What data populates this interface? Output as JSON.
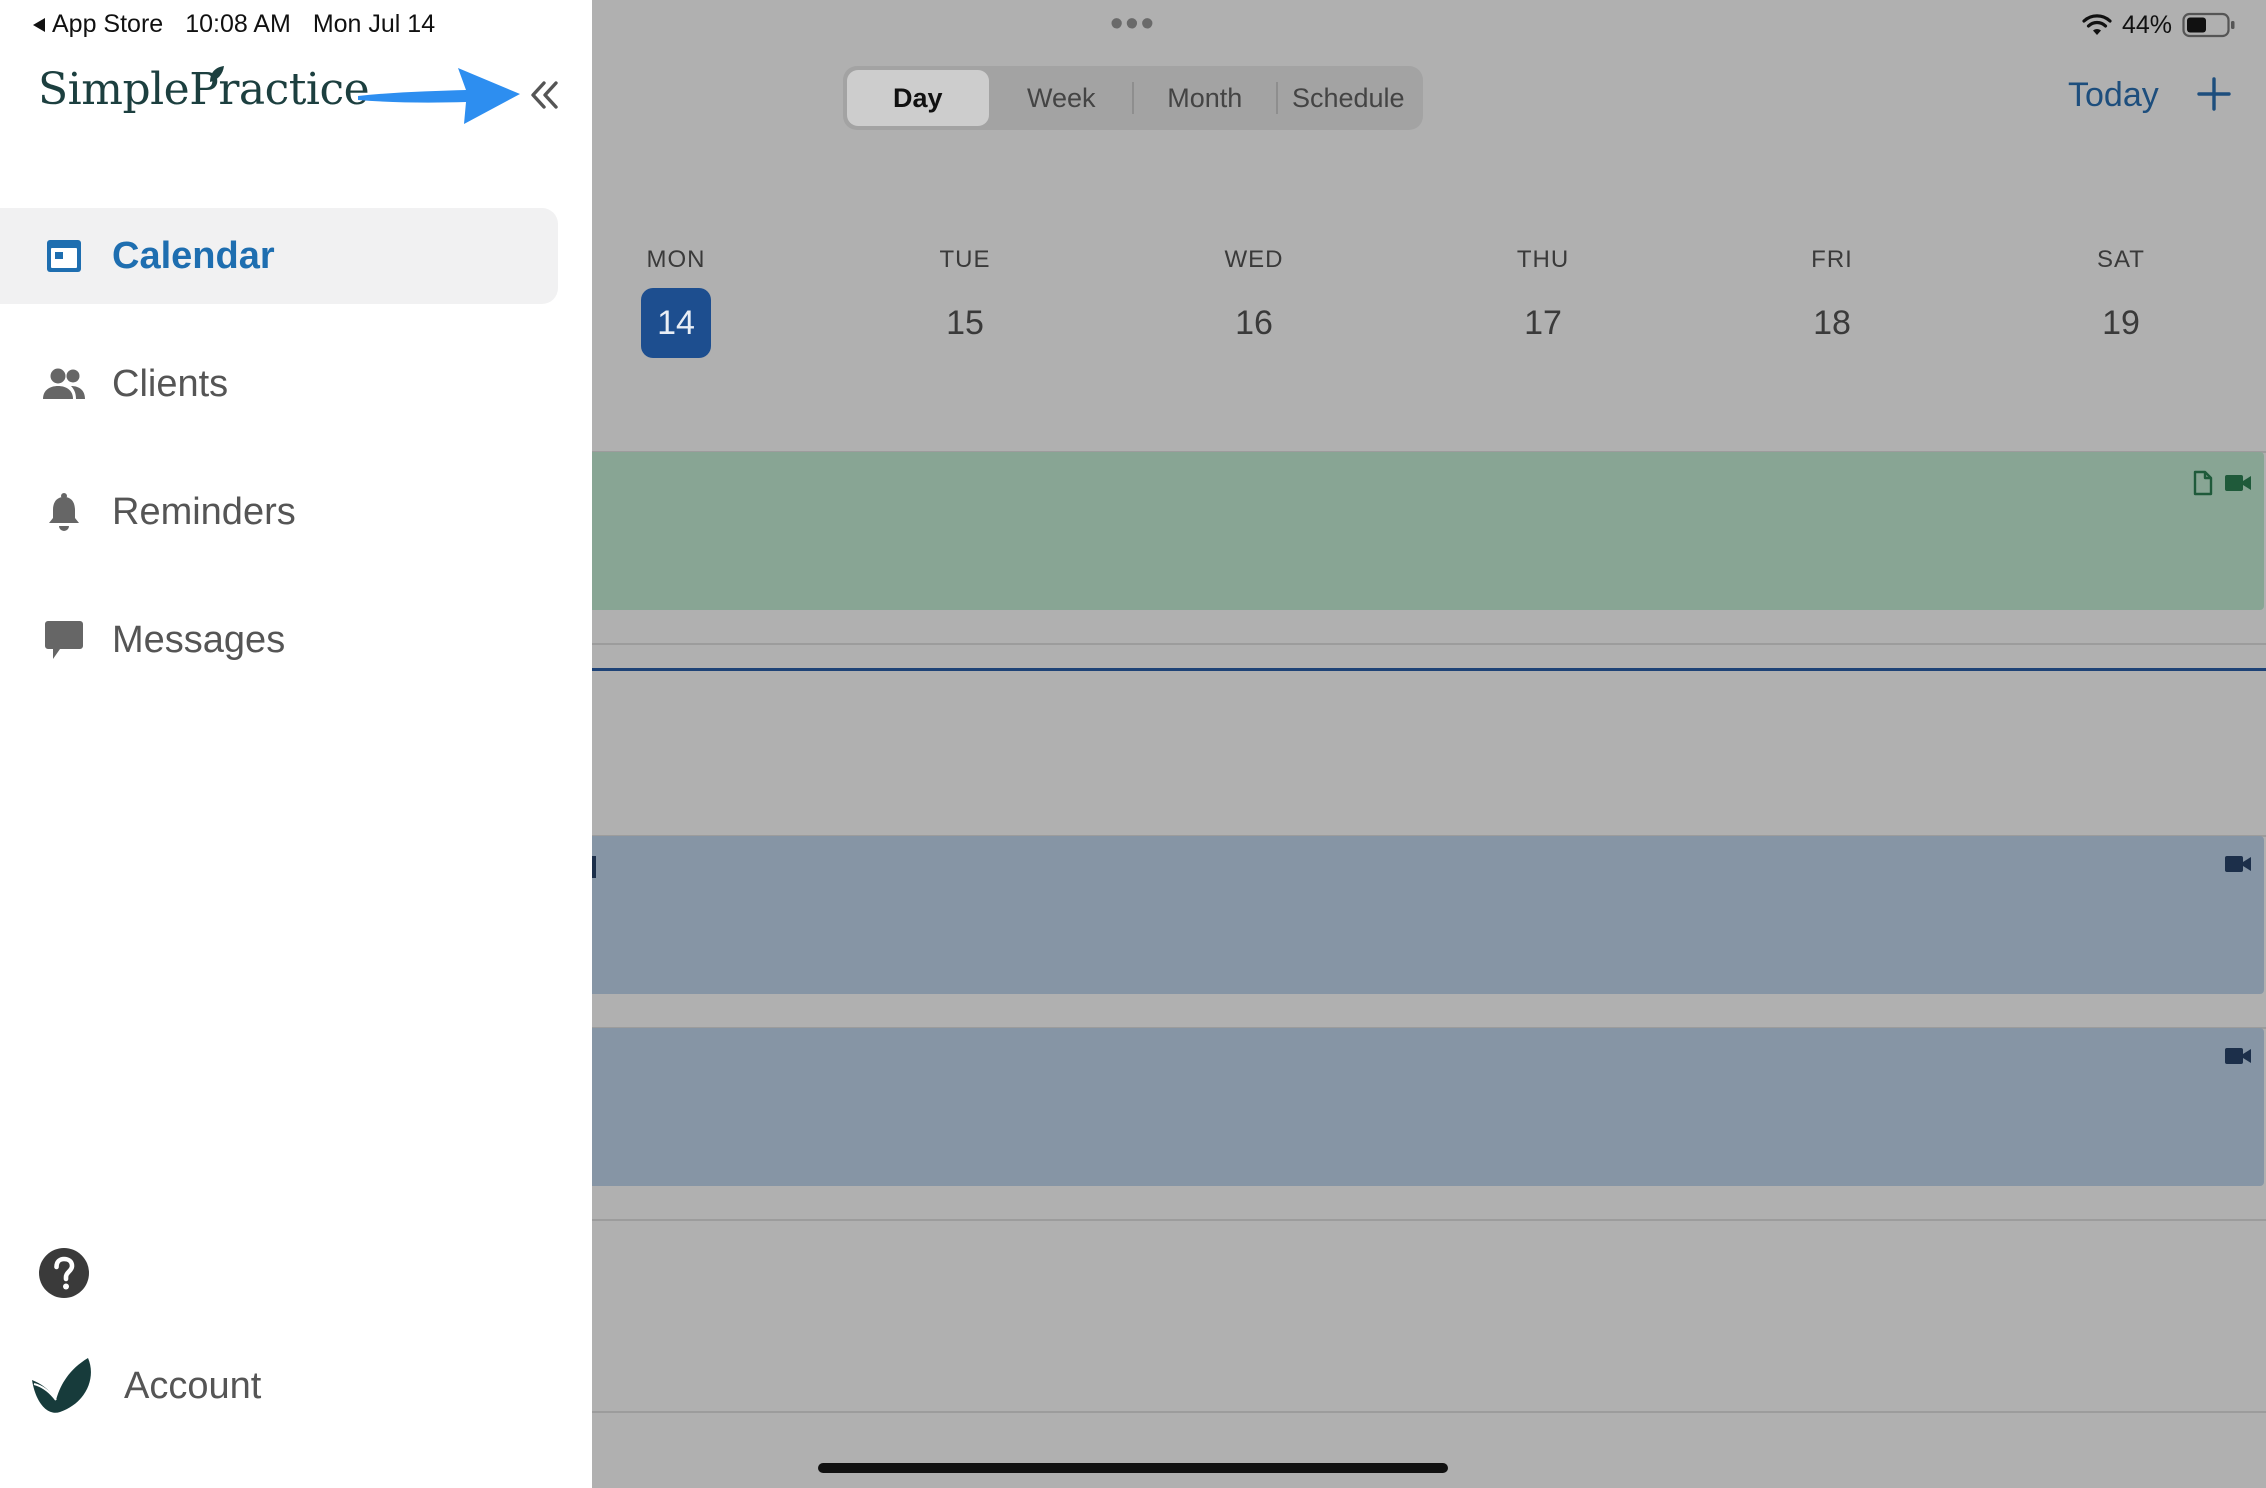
{
  "status_bar": {
    "back_app": "App Store",
    "time": "10:08 AM",
    "date": "Mon Jul 14",
    "battery": "44%"
  },
  "sidebar": {
    "logo": "SimplePractice",
    "items": [
      {
        "label": "Calendar",
        "icon": "calendar-icon",
        "active": true
      },
      {
        "label": "Clients",
        "icon": "clients-icon",
        "active": false
      },
      {
        "label": "Reminders",
        "icon": "bell-icon",
        "active": false
      },
      {
        "label": "Messages",
        "icon": "message-icon",
        "active": false
      }
    ],
    "help_icon": "question-icon",
    "account_label": "Account"
  },
  "calendar": {
    "view_tabs": [
      {
        "label": "Day",
        "active": true
      },
      {
        "label": "Week",
        "active": false
      },
      {
        "label": "Month",
        "active": false
      },
      {
        "label": "Schedule",
        "active": false
      }
    ],
    "today_label": "Today",
    "days": [
      {
        "name": "MON",
        "num": "14",
        "today": true
      },
      {
        "name": "TUE",
        "num": "15",
        "today": false
      },
      {
        "name": "WED",
        "num": "16",
        "today": false
      },
      {
        "name": "THU",
        "num": "17",
        "today": false
      },
      {
        "name": "FRI",
        "num": "18",
        "today": false
      },
      {
        "name": "SAT",
        "num": "19",
        "today": false
      }
    ]
  },
  "colors": {
    "accent": "#1e6eb0",
    "today_badge": "#1d4e8f",
    "event_green": "#88a594",
    "event_blue": "#8695a5",
    "annotation_arrow": "#2d8ef0"
  }
}
